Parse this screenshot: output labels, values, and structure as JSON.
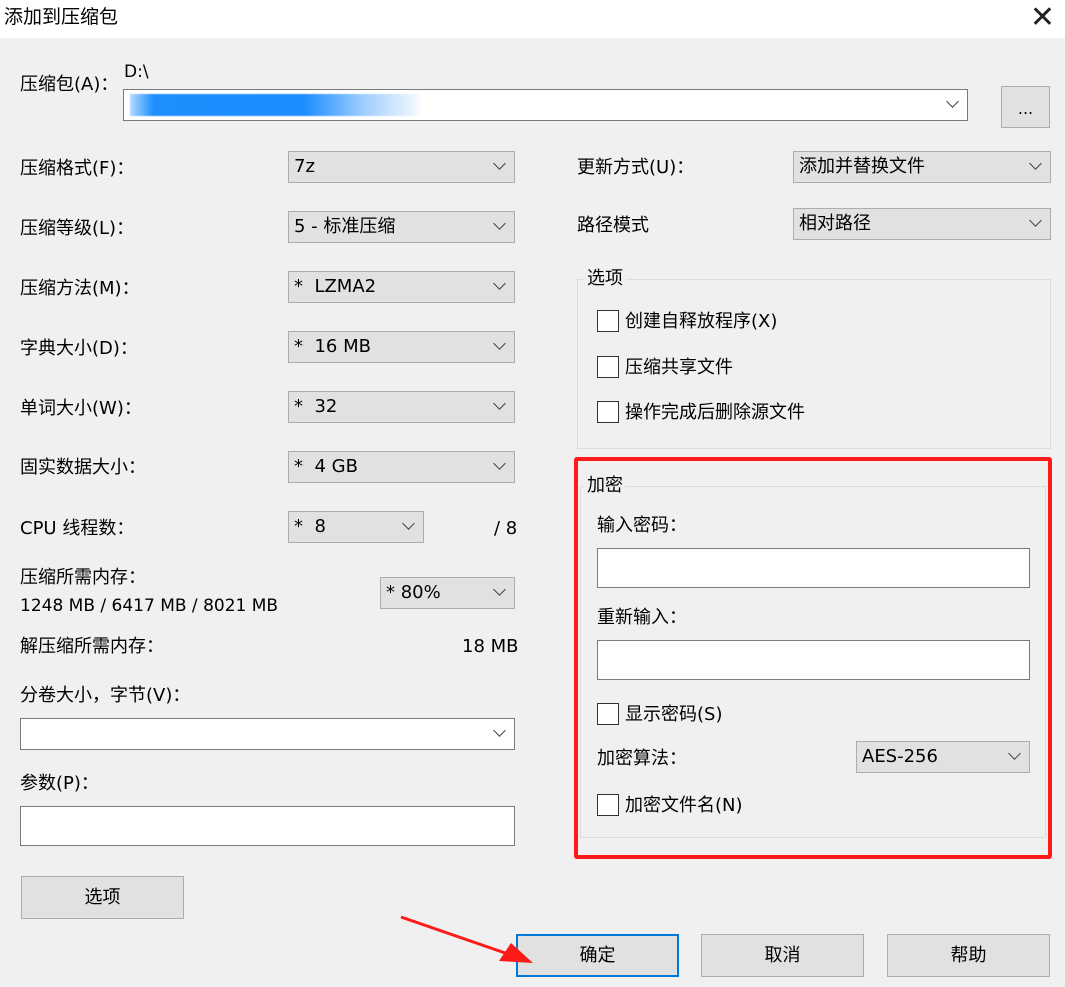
{
  "window": {
    "title": "添加到压缩包",
    "close_glyph": "✕"
  },
  "archive": {
    "label": "压缩包(A)：",
    "path_prefix": "D:\\",
    "browse_label": "..."
  },
  "left": {
    "format": {
      "label": "压缩格式(F)：",
      "value": "7z"
    },
    "level": {
      "label": "压缩等级(L)：",
      "value": "5 - 标准压缩"
    },
    "method": {
      "label": "压缩方法(M)：",
      "value": "*  LZMA2"
    },
    "dict": {
      "label": "字典大小(D)：",
      "value": "*  16 MB"
    },
    "word": {
      "label": "单词大小(W)：",
      "value": "*  32"
    },
    "solid": {
      "label": "固实数据大小：",
      "value": "*  4 GB"
    },
    "threads": {
      "label": "CPU 线程数：",
      "value": "*  8",
      "max": "/ 8"
    },
    "mem_compress": {
      "label": "压缩所需内存：",
      "detail": "1248 MB / 6417 MB / 8021 MB",
      "value": "* 80%"
    },
    "mem_decompress": {
      "label": "解压缩所需内存：",
      "value": "18 MB"
    },
    "volume": {
      "label": "分卷大小，字节(V)：",
      "value": ""
    },
    "params": {
      "label": "参数(P)：",
      "value": ""
    },
    "options_button": "选项"
  },
  "right": {
    "update": {
      "label": "更新方式(U)：",
      "value": "添加并替换文件"
    },
    "path_mode": {
      "label": "路径模式",
      "value": "相对路径"
    },
    "options": {
      "title": "选项",
      "items": [
        "创建自释放程序(X)",
        "压缩共享文件",
        "操作完成后删除源文件"
      ]
    },
    "encryption": {
      "title": "加密",
      "password_label": "输入密码：",
      "reenter_label": "重新输入：",
      "show_password": "显示密码(S)",
      "method_label": "加密算法：",
      "method_value": "AES-256",
      "encrypt_names": "加密文件名(N)"
    }
  },
  "buttons": {
    "ok": "确定",
    "cancel": "取消",
    "help": "帮助"
  },
  "colors": {
    "highlight": "#ff1a1a",
    "default_button_border": "#0078d7"
  }
}
